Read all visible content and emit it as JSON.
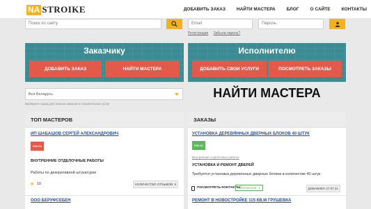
{
  "header": {
    "logo_na": "NA",
    "logo_rest": "STROIKE",
    "nav": [
      "ДОБАВИТЬ ЗАКАЗ",
      "НАЙТИ МАСТЕРА",
      "БЛОГ",
      "О САЙТЕ",
      "КОНТАКТЫ"
    ]
  },
  "search": {
    "placeholder": "Поиск по сайту"
  },
  "login": {
    "email_placeholder": "Email",
    "password_placeholder": "Пароль",
    "register": "Регистрация",
    "forgot": "Забыли пароль?"
  },
  "banners": {
    "customer": {
      "title": "Заказчику",
      "btn1": "ДОБАВИТЬ ЗАКАЗ",
      "btn2": "НАЙТИ МАСТЕРА"
    },
    "executor": {
      "title": "Исполнителю",
      "btn1": "ДОБАВИТЬ СВОИ УСЛУГИ",
      "btn2": "ПОСМОТРЕТЬ ЗАКАЗЫ"
    }
  },
  "filter": {
    "selected": "Вся Беларусь",
    "hint": "Выберите город для поиска заказов и строительных услуг"
  },
  "page_title": "НАЙТИ МАСТЕРА",
  "top_masters": {
    "title": "ТОП МАСТЕРОВ",
    "items": [
      {
        "name": "ИП ШАБАШОВ СЕРГЕЙ АЛЕКСАНДРОВИЧ",
        "city": "Минск",
        "category": "ВНУТРЕННИЕ ОТДЕЛОЧНЫЕ РАБОТЫ",
        "desc": "Работы по декоративной штукатурке",
        "rating": "10",
        "reviews": "КОЛИЧЕСТВО ОТЗЫВОВ: 6"
      },
      {
        "name": "ООО БЕРУФСЕБЕН"
      }
    ]
  },
  "orders": {
    "title": "ЗАКАЗЫ",
    "items": [
      {
        "name": "УСТАНОВКА ДЕРЕВЯННЫХ ДВЕРНЫХ БЛОКОВ 40 ШТУК",
        "city": "Минск",
        "category_link": "Внутренние отделочные работы",
        "category": "УСТАНОВКА И РЕМОНТ ДВЕРЕЙ",
        "desc": "Требуется установка деревянных дверных блоков в количестве 40 штук",
        "contacts": "ПОСМОТРЕТЬ КОНТАКТЫ",
        "views": "Просмотров: 1",
        "added": "ДОБАВЛЕН 27.07.21"
      },
      {
        "name": "РЕМОНТ В НОВОСТРОЙКЕ 115 КВ.М ГРУШЕВКА"
      }
    ]
  },
  "colors": {
    "accent": "#f6b21c",
    "teal": "#3c8a93",
    "button": "#e25b4a",
    "badge_red": "#e25b4a",
    "badge_green": "#5cb85c",
    "link": "#1e4fa8"
  }
}
